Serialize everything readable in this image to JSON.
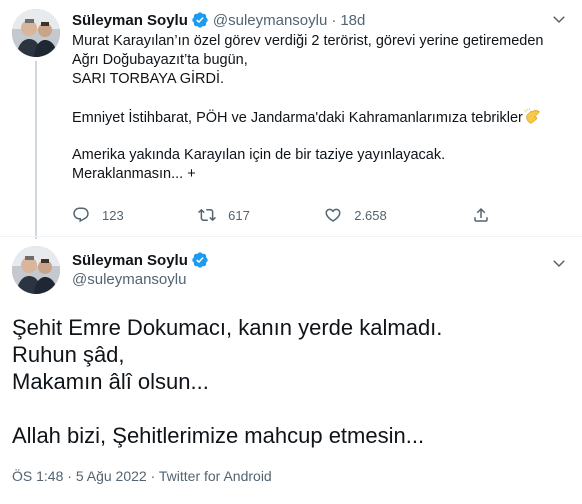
{
  "tweet1": {
    "name": "Süleyman Soylu",
    "handle": "@suleymansoylu",
    "separator": "·",
    "time": "18d",
    "lines": [
      "Murat Karayılan’ın özel görev verdiği 2 terörist, görevi yerine getiremeden",
      "Ağrı Doğubayazıt’ta bugün,",
      "SARI TORBAYA GİRDİ."
    ],
    "line4": "Emniyet İstihbarat, PÖH ve Jandarma'daki Kahramanlarımıza tebrikler",
    "lines_b": [
      "Amerika yakında Karayılan için de bir taziye yayınlayacak.",
      "Meraklanmasın... +"
    ],
    "stats": {
      "replies": "123",
      "retweets": "617",
      "likes": "2.658"
    }
  },
  "tweet2": {
    "name": "Süleyman Soylu",
    "handle": "@suleymansoylu",
    "lines": [
      "Şehit Emre Dokumacı, kanın yerde kalmadı.",
      "Ruhun şâd,",
      "Makamın âlî olsun...",
      "Allah bizi, Şehitlerimize mahcup etmesin..."
    ],
    "time": "ÖS 1:48",
    "date": "5 Ağu 2022",
    "source": "Twitter for Android",
    "meta_sep": "·"
  },
  "icons": {
    "verified": "verified-badge-icon",
    "more": "chevron-down-icon",
    "reply": "reply-icon",
    "retweet": "retweet-icon",
    "like": "heart-icon",
    "share": "share-icon",
    "clap": "clapping-hands-emoji"
  },
  "colors": {
    "verified": "#1d9bf0",
    "secondary_text": "#536471",
    "thread_line": "#cfd9de",
    "clap": "#f7c948"
  }
}
